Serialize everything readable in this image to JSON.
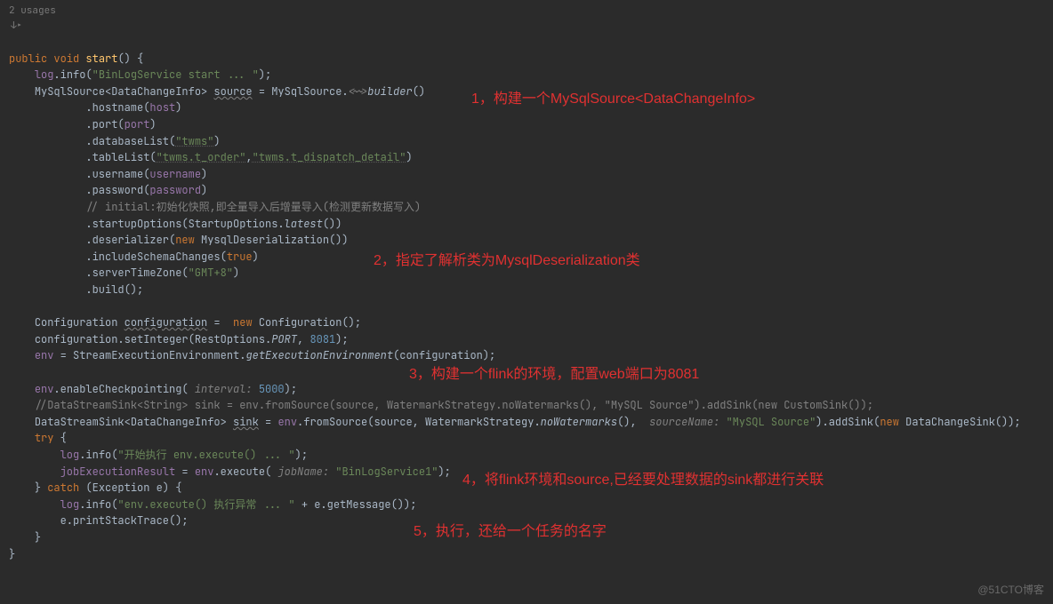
{
  "meta": {
    "usages_label": "2 usages",
    "gutter_icon": "↓▸"
  },
  "code": {
    "l1_kw1": "public",
    "l1_kw2": "void",
    "l1_ident": "start",
    "l1_tail": "() {",
    "l2_a": "log",
    "l2_b": ".info(",
    "l2_str": "\"BinLogService start ... \"",
    "l2_c": ");",
    "l3_a": "MySqlSource<DataChangeInfo> ",
    "l3_b": "source",
    "l3_c": " = MySqlSource.",
    "l3_hint": "<~>",
    "l3_d": "builder",
    "l3_e": "()",
    "l4_a": ".hostname(",
    "l4_b": "host",
    "l4_c": ")",
    "l5_a": ".port(",
    "l5_b": "port",
    "l5_c": ")",
    "l6_a": ".databaseList(",
    "l6_str": "\"twms\"",
    "l6_b": ")",
    "l7_a": ".tableList(",
    "l7_s1": "\"twms.t_order\"",
    "l7_b": ",",
    "l7_s2": "\"twms.t_dispatch_detail\"",
    "l7_c": ")",
    "l8_a": ".username(",
    "l8_b": "username",
    "l8_c": ")",
    "l9_a": ".password(",
    "l9_b": "password",
    "l9_c": ")",
    "l10": "// initial:初始化快照,即全量导入后增量导入(检测更新数据写入)",
    "l11_a": ".startupOptions(StartupOptions.",
    "l11_b": "latest",
    "l11_c": "())",
    "l12_a": ".deserializer(",
    "l12_kw": "new",
    "l12_b": " MysqlDeserialization())",
    "l13_a": ".includeSchemaChanges(",
    "l13_kw": "true",
    "l13_b": ")",
    "l14_a": ".serverTimeZone(",
    "l14_str": "\"GMT+8\"",
    "l14_b": ")",
    "l15": ".build();",
    "l17_a": "Configuration ",
    "l17_b": "configuration",
    "l17_c": " =  ",
    "l17_kw": "new",
    "l17_d": " Configuration();",
    "l18_a": "configuration.setInteger(RestOptions.",
    "l18_b": "PORT",
    "l18_c": ", ",
    "l18_num": "8081",
    "l18_d": ");",
    "l19_a": "env",
    "l19_b": " = StreamExecutionEnvironment.",
    "l19_c": "getExecutionEnvironment",
    "l19_d": "(configuration);",
    "l21_a": "env",
    "l21_b": ".enableCheckpointing(",
    "l21_hint": " interval: ",
    "l21_num": "5000",
    "l21_c": ");",
    "l22": "//DataStreamSink<String> sink = env.fromSource(source, WatermarkStrategy.noWatermarks(), \"MySQL Source\").addSink(new CustomSink());",
    "l23_a": "DataStreamSink<DataChangeInfo> ",
    "l23_b": "sink",
    "l23_c": " = ",
    "l23_d": "env",
    "l23_e": ".fromSource(source, WatermarkStrategy.",
    "l23_f": "noWatermarks",
    "l23_g": "(), ",
    "l23_hint": " sourceName: ",
    "l23_str": "\"MySQL Source\"",
    "l23_h": ").addSink(",
    "l23_kw": "new",
    "l23_i": " DataChangeSink());",
    "l24_kw": "try",
    "l24_a": " {",
    "l25_a": "log",
    "l25_b": ".info(",
    "l25_str": "\"开始执行 env.execute() ... \"",
    "l25_c": ");",
    "l26_a": "jobExecutionResult",
    "l26_b": " = ",
    "l26_c": "env",
    "l26_d": ".execute(",
    "l26_hint": " jobName: ",
    "l26_str": "\"BinLogService1\"",
    "l26_e": ");",
    "l27_a": "} ",
    "l27_kw": "catch",
    "l27_b": " (Exception e) {",
    "l28_a": "log",
    "l28_b": ".info(",
    "l28_str": "\"env.execute() 执行异常 ... \"",
    "l28_c": " + e.getMessage());",
    "l29": "e.printStackTrace();",
    "l30": "}",
    "l31": "}"
  },
  "annotations": {
    "a1": "1，构建一个MySqlSource<DataChangeInfo>",
    "a2": "2，指定了解析类为MysqlDeserialization类",
    "a3": "3，构建一个flink的环境，配置web端口为8081",
    "a4": "4，将flink环境和source,已经要处理数据的sink都进行关联",
    "a5": "5，执行，还给一个任务的名字"
  },
  "watermark": "@51CTO博客"
}
